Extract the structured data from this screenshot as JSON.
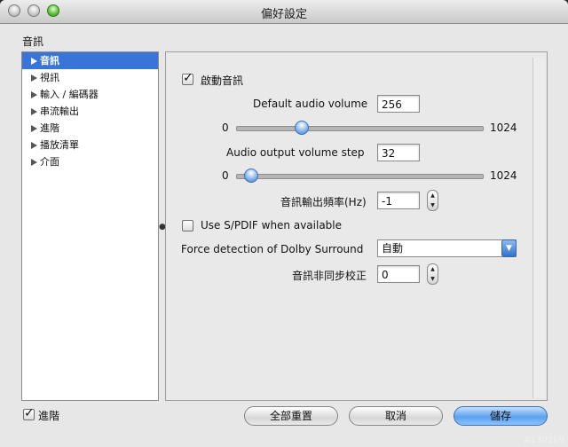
{
  "window": {
    "title": "偏好設定"
  },
  "section_label": "音訊",
  "sidebar": {
    "items": [
      {
        "label": "音訊",
        "selected": true
      },
      {
        "label": "視訊",
        "selected": false
      },
      {
        "label": "輸入 / 編碼器",
        "selected": false
      },
      {
        "label": "串流輸出",
        "selected": false
      },
      {
        "label": "進階",
        "selected": false
      },
      {
        "label": "播放清單",
        "selected": false
      },
      {
        "label": "介面",
        "selected": false
      }
    ]
  },
  "audio": {
    "enable_audio": {
      "label": "啟動音訊",
      "checked": true
    },
    "default_volume": {
      "label": "Default audio volume",
      "value": "256",
      "min": "0",
      "max": "1024"
    },
    "volume_step": {
      "label": "Audio output volume step",
      "value": "32",
      "min": "0",
      "max": "1024"
    },
    "output_rate": {
      "label": "音訊輸出頻率(Hz)",
      "value": "-1"
    },
    "spdif": {
      "label": "Use S/PDIF when available",
      "checked": false
    },
    "dolby": {
      "label": "Force detection of Dolby Surround",
      "value": "自動"
    },
    "desync": {
      "label": "音訊非同步校正",
      "value": "0"
    }
  },
  "footer": {
    "advanced": {
      "label": "進階",
      "checked": true
    },
    "reset": "全部重置",
    "cancel": "取消",
    "save": "儲存"
  },
  "watermark": "#130269"
}
